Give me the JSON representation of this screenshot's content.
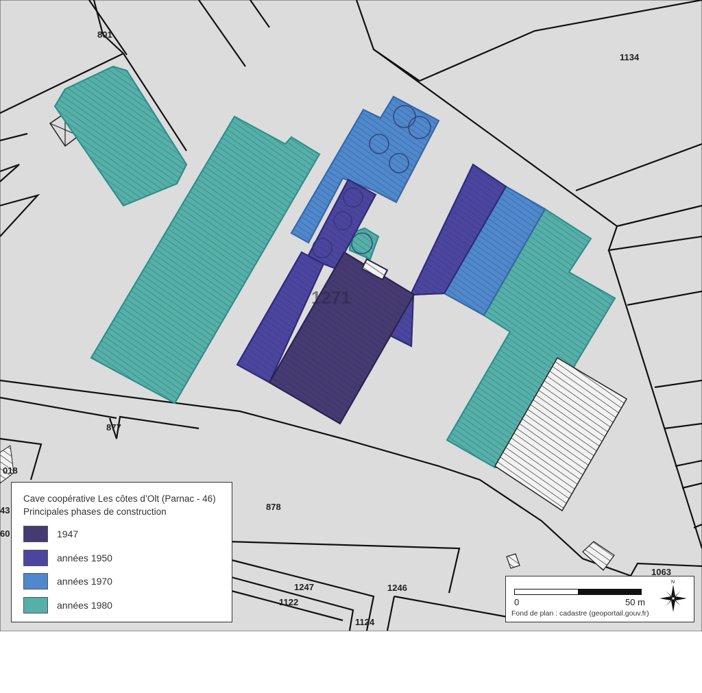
{
  "parcels": {
    "p801": "801",
    "p1134": "1134",
    "p1271": "1271",
    "p877": "877",
    "p878": "878",
    "p018": "018",
    "p43": "43",
    "p60": "60",
    "p1247": "1247",
    "p1246": "1246",
    "p1122": "1122",
    "p1124": "1124",
    "p1063": "1063"
  },
  "legend": {
    "title_line1": "Cave coopérative Les côtes d’Olt (Parnac - 46)",
    "title_line2": "Principales phases de construction",
    "items": [
      {
        "label": "1947",
        "color": "#463a72"
      },
      {
        "label": "années 1950",
        "color": "#4c45a0"
      },
      {
        "label": "années 1970",
        "color": "#4f88cc"
      },
      {
        "label": "années 1980",
        "color": "#54b0a8"
      }
    ]
  },
  "scale": {
    "start": "0",
    "end": "50 m",
    "north": "N",
    "source": "Fond de plan : cadastre (geoportail.gouv.fr)"
  },
  "colors": {
    "background": "#dcdcdc",
    "parcel_lines": "#111111"
  }
}
